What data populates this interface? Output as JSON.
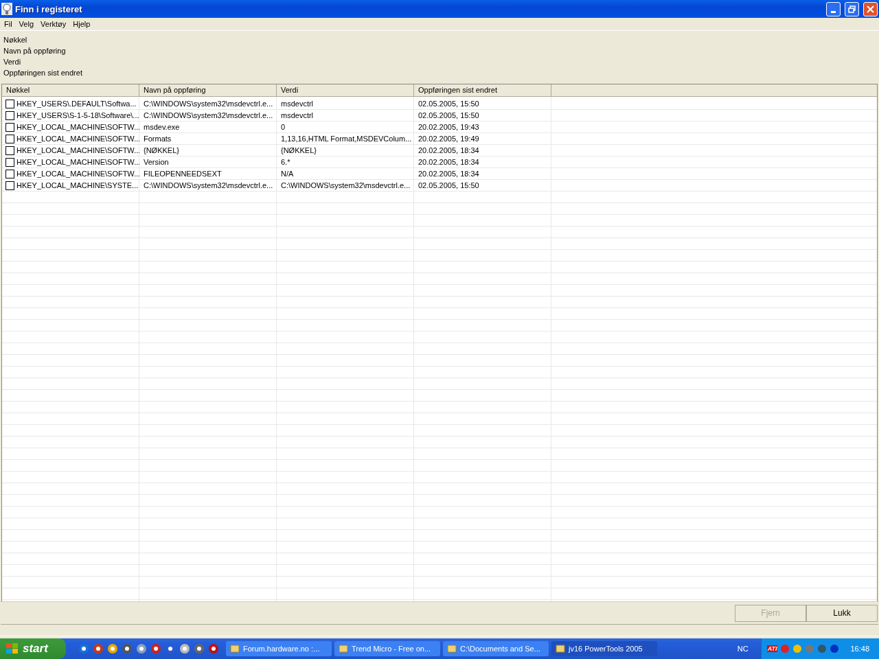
{
  "window": {
    "title": "Finn i registeret"
  },
  "menu": [
    "Fil",
    "Velg",
    "Verktøy",
    "Hjelp"
  ],
  "filter_labels": [
    "Nøkkel",
    "Navn på oppføring",
    "Verdi",
    "Oppføringen sist endret"
  ],
  "table": {
    "columns": [
      "Nøkkel",
      "Navn på oppføring",
      "Verdi",
      "Oppføringen sist endret"
    ],
    "rows": [
      {
        "checked": false,
        "cells": [
          "HKEY_USERS\\.DEFAULT\\Softwa...",
          "C:\\WINDOWS\\system32\\msdevctrl.e...",
          "msdevctrl",
          "02.05.2005, 15:50"
        ]
      },
      {
        "checked": false,
        "cells": [
          "HKEY_USERS\\S-1-5-18\\Software\\...",
          "C:\\WINDOWS\\system32\\msdevctrl.e...",
          "msdevctrl",
          "02.05.2005, 15:50"
        ]
      },
      {
        "checked": false,
        "cells": [
          "HKEY_LOCAL_MACHINE\\SOFTW...",
          "msdev.exe",
          "0",
          "20.02.2005, 19:43"
        ]
      },
      {
        "checked": false,
        "cells": [
          "HKEY_LOCAL_MACHINE\\SOFTW...",
          "Formats",
          "1,13,16,HTML Format,MSDEVColum...",
          "20.02.2005, 19:49"
        ]
      },
      {
        "checked": false,
        "cells": [
          "HKEY_LOCAL_MACHINE\\SOFTW...",
          "{NØKKEL}",
          "{NØKKEL}",
          "20.02.2005, 18:34"
        ]
      },
      {
        "checked": false,
        "cells": [
          "HKEY_LOCAL_MACHINE\\SOFTW...",
          "Version",
          "6.*",
          "20.02.2005, 18:34"
        ]
      },
      {
        "checked": false,
        "cells": [
          "HKEY_LOCAL_MACHINE\\SOFTW...",
          "FILEOPENNEEDSEXT",
          "N/A",
          "20.02.2005, 18:34"
        ]
      },
      {
        "checked": false,
        "cells": [
          "HKEY_LOCAL_MACHINE\\SYSTE...",
          "C:\\WINDOWS\\system32\\msdevctrl.e...",
          "C:\\WINDOWS\\system32\\msdevctrl.e...",
          "02.05.2005, 15:50"
        ]
      }
    ]
  },
  "buttons": [
    {
      "label": "Fjern",
      "disabled": true
    },
    {
      "label": "Lukk",
      "disabled": false
    }
  ],
  "taskbar": {
    "start": "start",
    "tasks": [
      {
        "label": "Forum.hardware.no :...",
        "selected": false
      },
      {
        "label": "Trend Micro - Free on...",
        "selected": false
      },
      {
        "label": "C:\\Documents and Se...",
        "selected": false
      },
      {
        "label": "jv16 PowerTools 2005",
        "selected": true
      }
    ],
    "language": "NC",
    "tray_logo": "ATI",
    "clock": "16:48"
  }
}
